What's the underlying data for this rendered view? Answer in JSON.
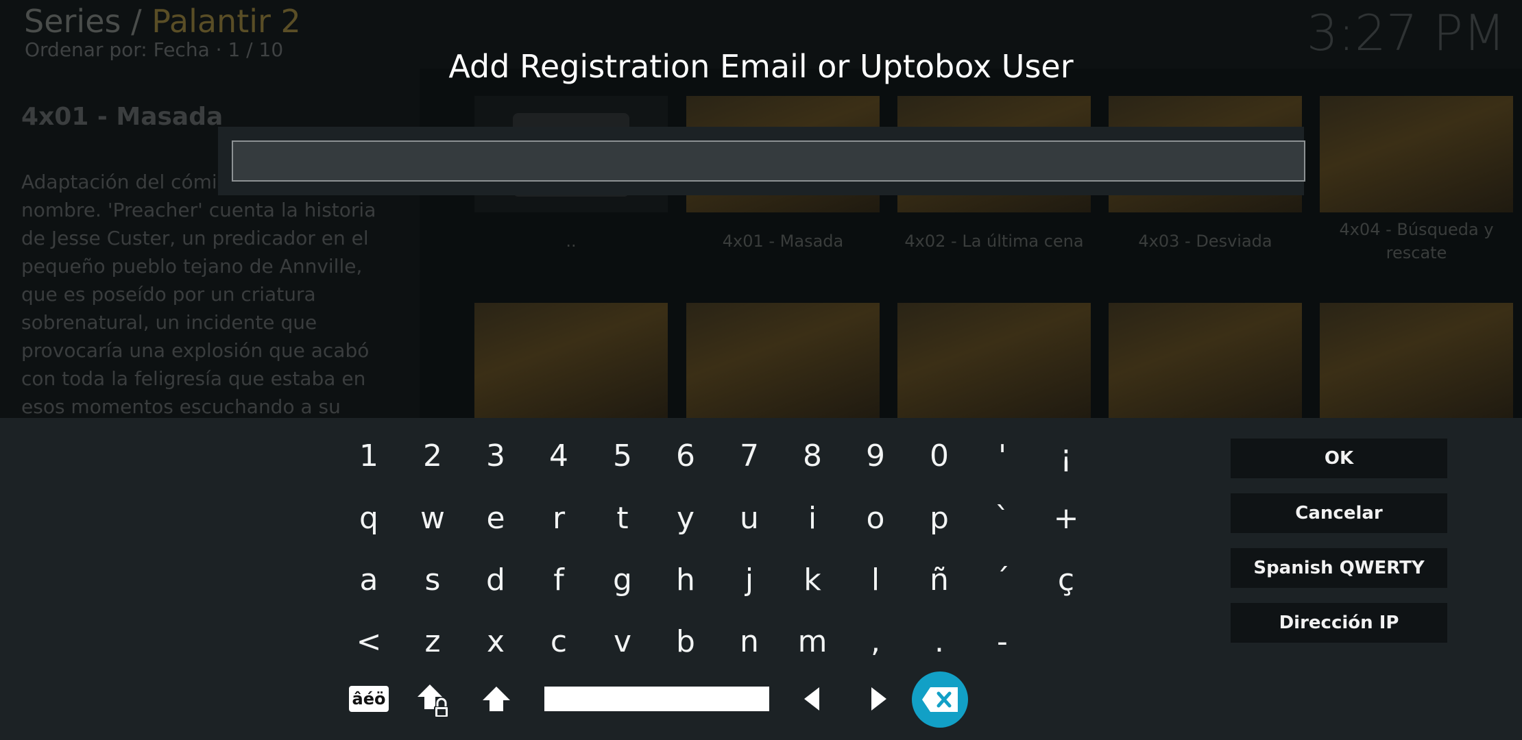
{
  "background": {
    "path_section": "Series /",
    "path_show": "Palantir 2",
    "sort_label": "Ordenar por: Fecha",
    "sort_sep": "·",
    "page_indicator": "1 / 10",
    "clock": "3:27 PM",
    "episode_title": "4x01 - Masada",
    "plot": "Adaptación del cómic del mismo nombre. 'Preacher' cuenta la historia de Jesse Custer, un predicador en el pequeño pueblo tejano de Annville, que es poseído por un criatura sobrenatural, un incidente que provocaría una explosión que acabó con toda la feligresía que estaba en esos momentos escuchando a su",
    "tiles": [
      "..",
      "4x01 - Masada",
      "4x02 - La última cena",
      "4x03 - Desviada",
      "4x04 - Búsqueda y rescate"
    ]
  },
  "dialog": {
    "heading": "Add Registration Email or Uptobox User",
    "input_value": ""
  },
  "keyboard": {
    "rows": [
      [
        "1",
        "2",
        "3",
        "4",
        "5",
        "6",
        "7",
        "8",
        "9",
        "0",
        "'",
        "¡"
      ],
      [
        "q",
        "w",
        "e",
        "r",
        "t",
        "y",
        "u",
        "i",
        "o",
        "p",
        "`",
        "+"
      ],
      [
        "a",
        "s",
        "d",
        "f",
        "g",
        "h",
        "j",
        "k",
        "l",
        "ñ",
        "´",
        "ç"
      ],
      [
        "<",
        "z",
        "x",
        "c",
        "v",
        "b",
        "n",
        "m",
        ",",
        ".",
        "-"
      ]
    ],
    "symbols_key_label": "âéö",
    "bottom_icons": [
      "symbols-key",
      "caps-lock-icon",
      "shift-icon",
      "space-key",
      "cursor-left-icon",
      "cursor-right-icon",
      "backspace-icon"
    ],
    "accent_color": "#12a0c6"
  },
  "buttons": {
    "ok": "OK",
    "cancel": "Cancelar",
    "layout": "Spanish QWERTY",
    "ip": "Dirección IP"
  }
}
